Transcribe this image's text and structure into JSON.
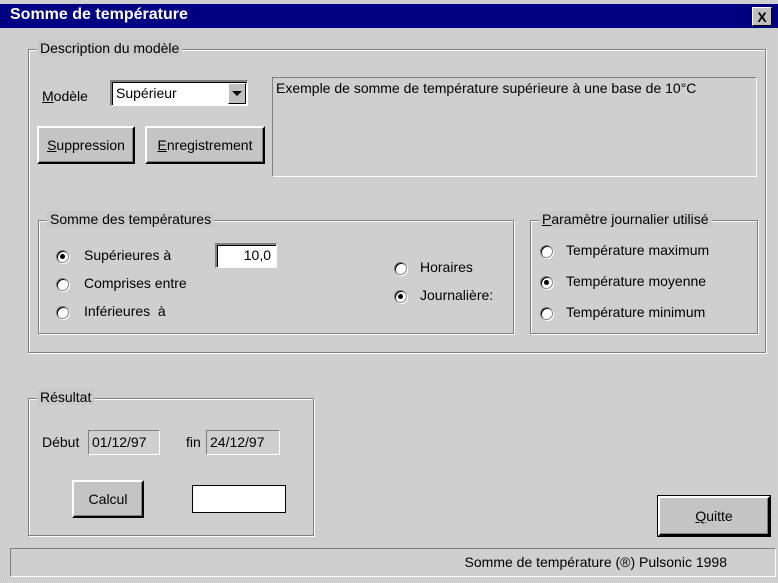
{
  "window": {
    "title": "Somme de température",
    "close_label": "X"
  },
  "model_group": {
    "legend": "Description du modèle",
    "model_label_u": "M",
    "model_label_rest": "odèle",
    "model_selected": "Supérieur",
    "description": "Exemple de somme de température supérieure à une base de 10°C",
    "delete_button_u": "S",
    "delete_button_rest": "uppression",
    "save_button_u": "E",
    "save_button_rest": "nregistrement"
  },
  "sum_group": {
    "legend": "Somme des températures",
    "options": [
      {
        "label": "Supérieures à",
        "checked": true
      },
      {
        "label": "Comprises entre",
        "checked": false
      },
      {
        "label": "Inférieures  à",
        "checked": false
      }
    ],
    "threshold_value": "10,0",
    "period_options": [
      {
        "label": "Horaires",
        "checked": false
      },
      {
        "label": "Journalière:",
        "checked": true
      }
    ]
  },
  "param_group": {
    "legend_u": "P",
    "legend_rest": "aramètre journalier utilisé",
    "options": [
      {
        "label": "Température maximum",
        "checked": false
      },
      {
        "label": "Température moyenne",
        "checked": true
      },
      {
        "label": "Température minimum",
        "checked": false
      }
    ]
  },
  "result_group": {
    "legend": "Résultat",
    "start_label": "Début",
    "start_value": "01/12/97",
    "end_label": "fin",
    "end_value": "24/12/97",
    "calc_button": "Calcul",
    "result_value": ""
  },
  "quit_button_u": "Q",
  "quit_button_rest": "uitte",
  "status": "Somme de température (®) Pulsonic 1998"
}
